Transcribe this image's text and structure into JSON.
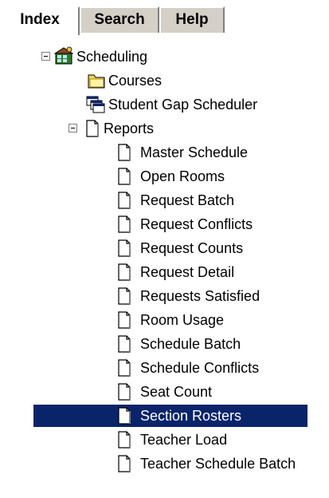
{
  "tabs": [
    {
      "label": "Index",
      "active": true
    },
    {
      "label": "Search",
      "active": false
    },
    {
      "label": "Help",
      "active": false
    }
  ],
  "tree": {
    "root": {
      "label": "Scheduling",
      "icon": "scheduling-folder-icon",
      "expanded": true
    },
    "items": [
      {
        "label": "Courses",
        "icon": "folder-icon"
      },
      {
        "label": "Student Gap Scheduler",
        "icon": "windows-stack-icon"
      },
      {
        "label": "Reports",
        "icon": "document-icon",
        "expanded": true
      }
    ],
    "reports": [
      {
        "label": "Master Schedule"
      },
      {
        "label": "Open Rooms"
      },
      {
        "label": "Request Batch"
      },
      {
        "label": "Request Conflicts"
      },
      {
        "label": "Request Counts"
      },
      {
        "label": "Request Detail"
      },
      {
        "label": "Requests Satisfied"
      },
      {
        "label": "Room Usage"
      },
      {
        "label": "Schedule Batch"
      },
      {
        "label": "Schedule Conflicts"
      },
      {
        "label": "Seat Count"
      },
      {
        "label": "Section Rosters",
        "selected": true
      },
      {
        "label": "Teacher Load"
      },
      {
        "label": "Teacher Schedule Batch"
      }
    ]
  },
  "colors": {
    "selection": "#0a246a",
    "tab_face": "#d4d0c8"
  }
}
